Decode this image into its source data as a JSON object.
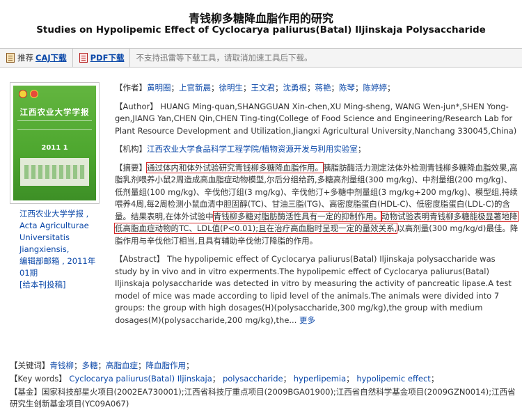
{
  "header": {
    "title_cn": "青钱柳多糖降血脂作用的研究",
    "title_en": "Studies on Hypolipemic Effect of Cyclocarya paliurus(Batal) Iljinskaja Polysaccharide"
  },
  "toolbar": {
    "recommend_prefix": "推荐",
    "caj_label": "CAJ下载",
    "pdf_label": "PDF下载",
    "note": "不支持迅雷等下载工具，请取消加速工具后下载。"
  },
  "cover": {
    "title": "江西农业大学学报",
    "issue": "2011 1"
  },
  "journal": {
    "name_cn": "江西农业大学学报 ,",
    "name_en_1": "Acta Agriculturae",
    "name_en_2": "Universitatis",
    "name_en_3": "Jiangxiensis,",
    "editor": "编辑部邮箱 , 2011年",
    "issue": "01期",
    "submit": "[给本刊投稿]"
  },
  "authors": {
    "label": "【作者】",
    "names": [
      "黄明圈",
      "上官新晨",
      "徐明生",
      "王文君",
      "沈勇根",
      "蒋艳",
      "陈琴",
      "陈婷婷"
    ]
  },
  "author_en": {
    "label": "【Author】",
    "text": "HUANG Ming-quan,SHANGGUAN Xin-chen,XU Ming-sheng, WANG Wen-jun*,SHEN Yong-gen,JIANG Yan,CHEN Qin,CHEN Ting-ting(College of Food Science and Engineering/Research Lab for Plant Resource Development and Utilization,Jiangxi Agricultural University,Nanchang 330045,China)"
  },
  "institution": {
    "label": "【机构】",
    "text": "江西农业大学食品科学工程学院/植物资源开发与利用实验室",
    "suffix": "；"
  },
  "abstract_cn": {
    "label": "【摘要】",
    "part1": "通过体内和体外试验研究青钱柳多糖降血脂作用。",
    "part2": "胰脂肪酶活力测定法体外检测青钱柳多糖降血脂效果,高脂乳剂喂养小鼠2周造成高血脂症动物模型,尔后分组给药,多糖高剂量组(300 mg/kg)、中剂量组(200 mg/kg)、低剂量组(100 mg/kg)、辛伐他汀组(3 mg/kg)、辛伐他汀+多糖中剂量组(3 mg/kg+200 mg/kg)、模型组,持续喂养4周,每2周检测小鼠血清中胆固醇(TC)、甘油三脂(TG)、高密度脂蛋白(HDL-C)、低密度脂蛋白(LDL-C)的含量。结果表明,在体外试验中",
    "part3": "青钱柳多糖对脂肪酶活性具有一定的抑制作用。",
    "part4": "动物试验表明青钱柳多糖能极显著地降低高脂血症动物的TC、LDL值(P<0.01);且在治疗高血脂时呈现一定的量效关系,",
    "part5": "以高剂量(300 mg/kg/d)最佳。降脂作用与辛伐他汀相当,且具有辅助辛伐他汀降脂的作用。"
  },
  "abstract_en": {
    "label": "【Abstract】",
    "text": "The hypolipemic effect of Cyclocarya paliurus(Batal) Iljinskaja polysaccharide was study by in vivo and in vitro experments.The hypolipemic effect of Cyclocarya paliurus(Batal) Iljinskaja polysaccharide was detected in vitro by measuring the activity of pancreatic lipase.A test model of mice was made according to lipid level of the animals.The animals were divided into 7 groups: the group with high dosages(H)(polysaccharide,300 mg/kg),the group with medium dosages(M)(polysaccharide,200 mg/kg),the...",
    "more": "更多"
  },
  "keywords_cn": {
    "label": "【关键词】",
    "items": [
      "青钱柳",
      "多糖",
      "高脂血症",
      "降血脂作用"
    ]
  },
  "keywords_en": {
    "label": "【Key words】",
    "items": [
      "Cyclocarya paliurus(Batal) Iljinskaja",
      "polysaccharide",
      "hyperlipemia",
      "hypolipemic effect"
    ]
  },
  "fund": {
    "label": "【基金】",
    "text": "国家科技部星火项目(2002EA730001);江西省科技厅重点项目(2009BGA01900);江西省自然科学基金项目(2009GZN0014);江西省研究生创新基金项目(YC09A067)"
  },
  "colors": {
    "link": "#0a47a8",
    "highlight_box": "#d42828",
    "cover_green": "#4fa830"
  }
}
